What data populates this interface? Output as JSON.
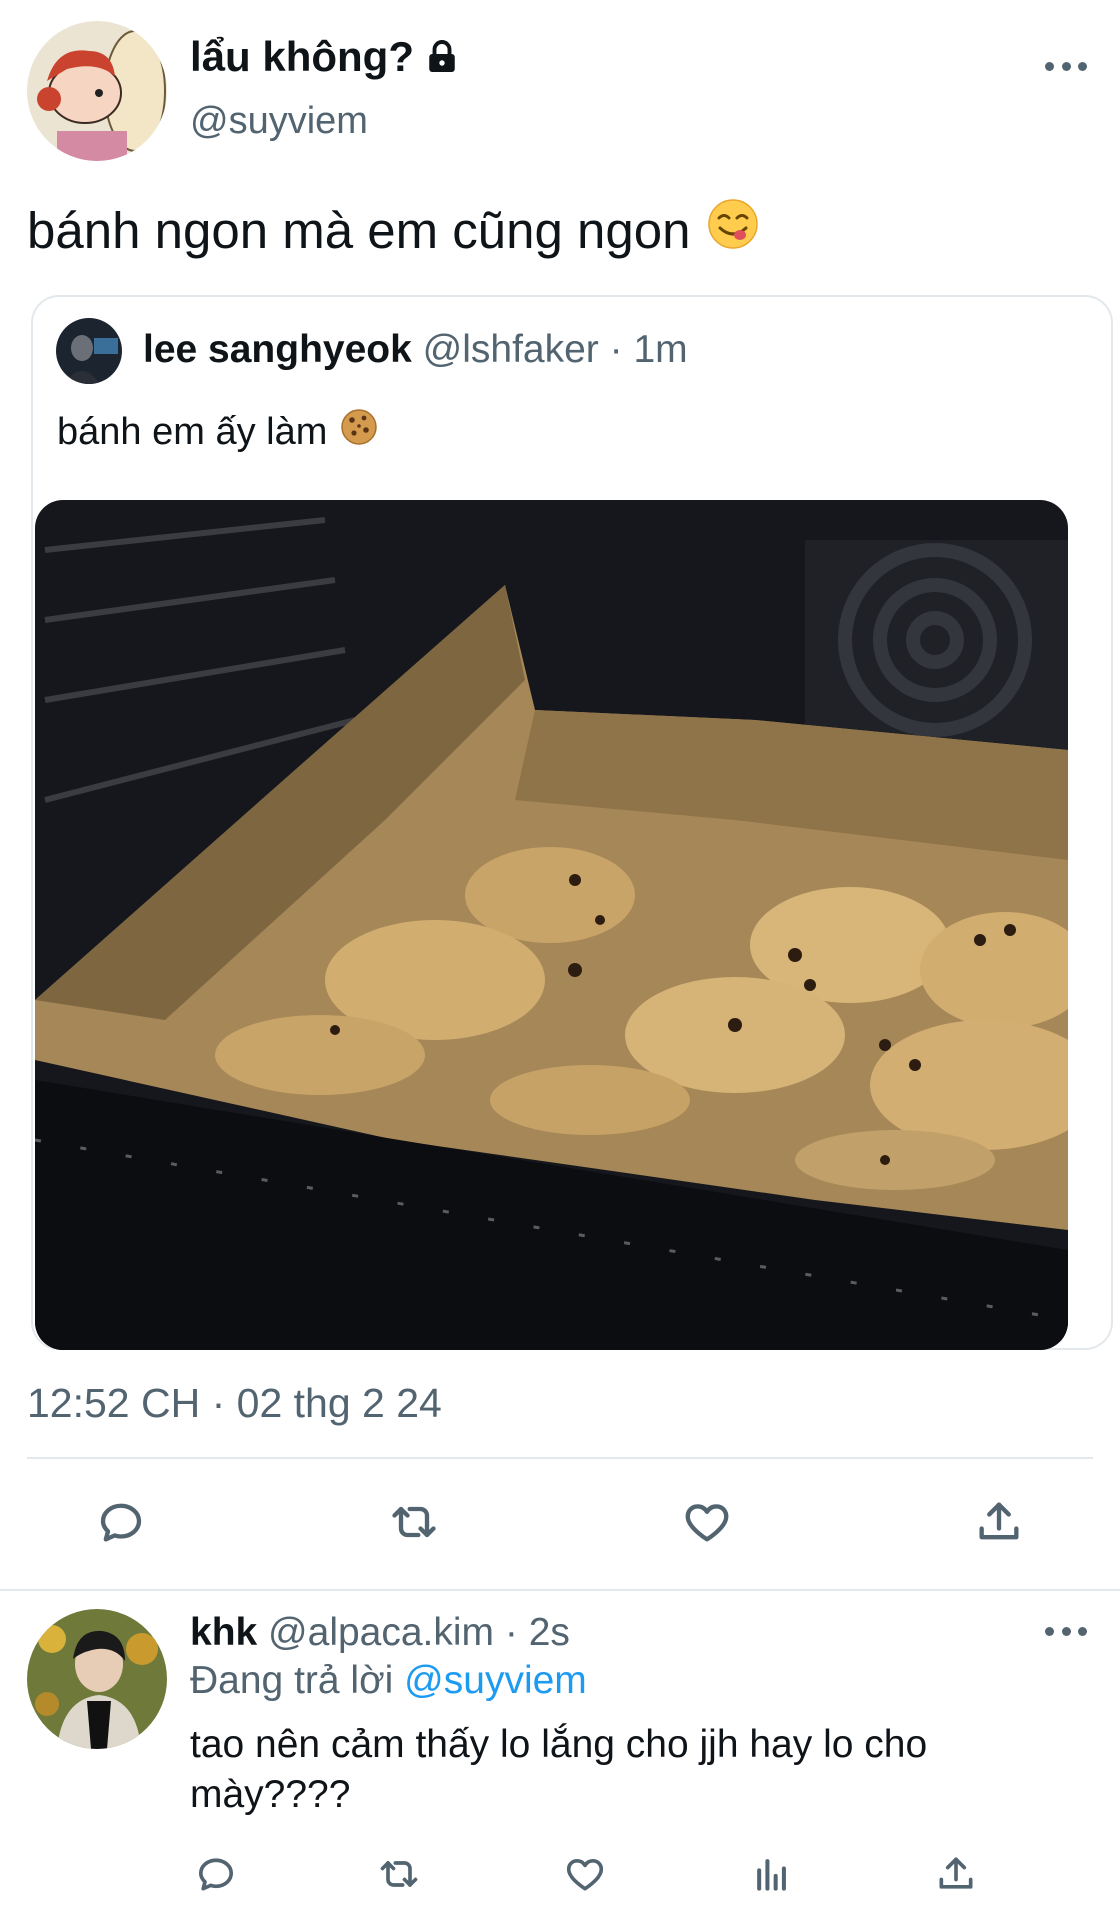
{
  "tweet": {
    "author_name": "lẩu không?",
    "author_handle": "@suyviem",
    "text": "bánh ngon mà em cũng ngon",
    "emoji": "😋",
    "quoted": {
      "author_name": "lee sanghyeok",
      "meta": "@lshfaker · 1m",
      "text": "bánh em ấy làm",
      "emoji": "🍪"
    },
    "timestamp": "12:52 CH · 02 thg 2 24"
  },
  "actions": [
    "reply-icon",
    "retweet-icon",
    "like-icon",
    "share-icon"
  ],
  "reply": {
    "author_name": "khk",
    "meta": "@alpaca.kim · 2s",
    "replying_label": "Đang trả lời",
    "replying_to": "@suyviem",
    "text": "tao nên cảm thấy lo lắng cho jjh hay lo cho mày????",
    "actions": [
      "reply-icon",
      "retweet-icon",
      "like-icon",
      "views-icon",
      "share-icon"
    ]
  },
  "colors": {
    "text": "#0f1419",
    "secondary": "#536471",
    "accent": "#1d9bf0",
    "border": "#e3e8ec"
  }
}
